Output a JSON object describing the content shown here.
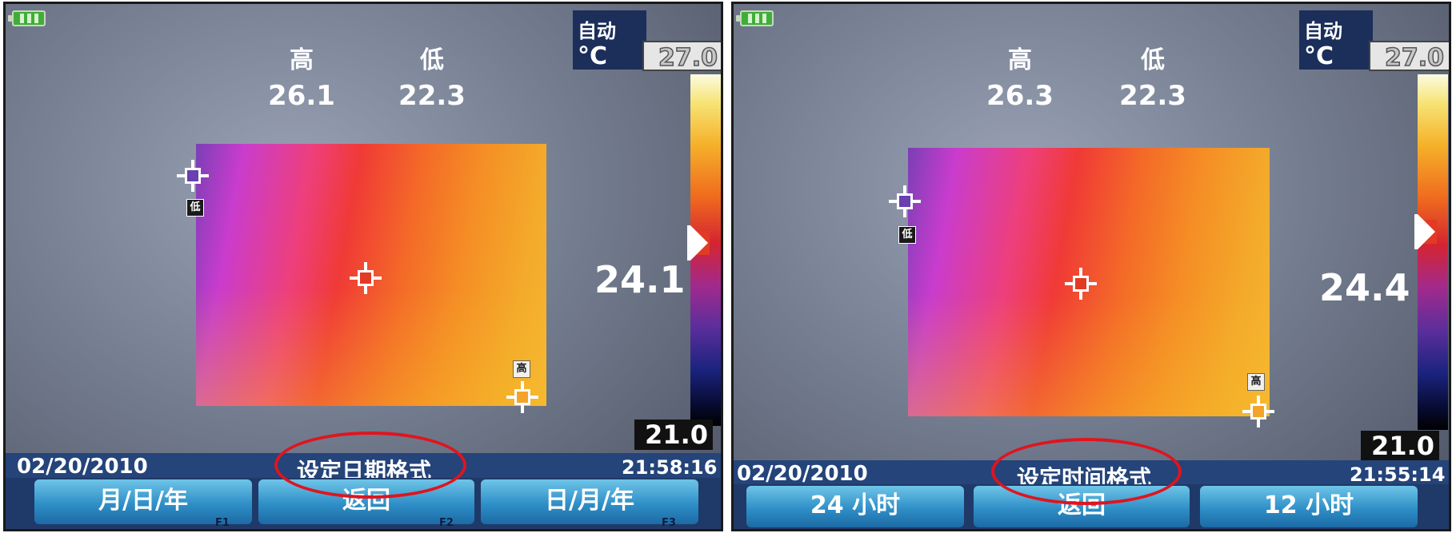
{
  "screens": [
    {
      "high_label": "高",
      "low_label": "低",
      "high_value": "26.1",
      "low_value": "22.3",
      "mode": "自动",
      "unit": "°C",
      "scale_max": "27.0",
      "level_value": "24.1",
      "scale_min": "21.0",
      "low_tag": "低",
      "high_tag": "高",
      "date": "02/20/2010",
      "menu_title": "设定日期格式",
      "time": "21:58:16",
      "softkeys": [
        "月/日/年",
        "返回",
        "日/月/年"
      ],
      "fkeys": [
        "F1",
        "F2",
        "F3"
      ]
    },
    {
      "high_label": "高",
      "low_label": "低",
      "high_value": "26.3",
      "low_value": "22.3",
      "mode": "自动",
      "unit": "°C",
      "scale_max": "27.0",
      "level_value": "24.4",
      "scale_min": "21.0",
      "low_tag": "低",
      "high_tag": "高",
      "date": "02/20/2010",
      "menu_title": "设定时间格式",
      "time": "21:55:14",
      "softkeys": [
        "24 小时",
        "返回",
        "12 小时"
      ],
      "fkeys": [
        "F1",
        "F2",
        "F3"
      ]
    }
  ],
  "colors": {
    "highlight": "#e0141e",
    "status_bar": "#24447a",
    "softkey": "#2f8fc7"
  }
}
